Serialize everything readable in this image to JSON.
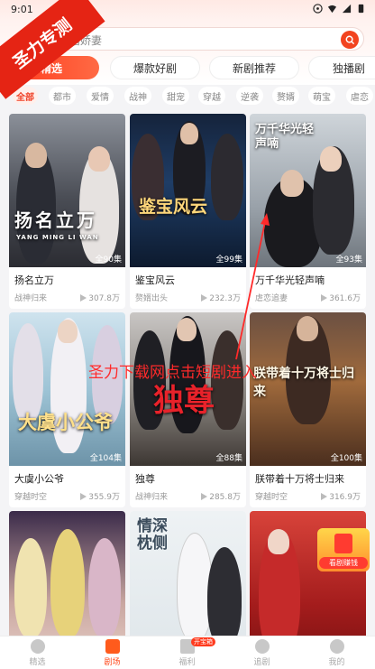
{
  "status": {
    "time": "9:01"
  },
  "watermark": {
    "text": "圣力专测"
  },
  "search": {
    "placeholder": "闪婚娇妻"
  },
  "tabs": [
    {
      "label": "精选",
      "active": true
    },
    {
      "label": "爆款好剧",
      "active": false
    },
    {
      "label": "新剧推荐",
      "active": false
    },
    {
      "label": "独播剧",
      "active": false
    }
  ],
  "categories": [
    {
      "label": "全部",
      "active": true
    },
    {
      "label": "都市"
    },
    {
      "label": "爱情"
    },
    {
      "label": "战神"
    },
    {
      "label": "甜宠"
    },
    {
      "label": "穿越"
    },
    {
      "label": "逆袭"
    },
    {
      "label": "赘婿"
    },
    {
      "label": "萌宝"
    },
    {
      "label": "虐恋"
    }
  ],
  "cards": [
    {
      "title": "扬名立万",
      "episodes": "全90集",
      "tag": "战神归来",
      "views": "307.8万",
      "poster_text": "扬名立万",
      "poster_sub": "YANG MING LI WAN"
    },
    {
      "title": "鉴宝风云",
      "episodes": "全99集",
      "tag": "赘婿出头",
      "views": "232.3万",
      "poster_text": "鉴宝风云"
    },
    {
      "title": "万千华光轻声喃",
      "episodes": "全93集",
      "tag": "虐恋追妻",
      "views": "361.6万",
      "poster_text": "万千华光轻声喃"
    },
    {
      "title": "大虞小公爷",
      "episodes": "全104集",
      "tag": "穿越时空",
      "views": "355.9万",
      "poster_text": "大虞小公爷"
    },
    {
      "title": "独尊",
      "episodes": "全88集",
      "tag": "战神归来",
      "views": "285.8万",
      "poster_text": "独尊"
    },
    {
      "title": "朕带着十万将士归来",
      "episodes": "全100集",
      "tag": "穿越时空",
      "views": "316.9万",
      "poster_text": "朕带着十万将士归来"
    },
    {
      "title": "",
      "episodes": "",
      "tag": "",
      "views": "",
      "poster_text": ""
    },
    {
      "title": "",
      "episodes": "",
      "tag": "",
      "views": "",
      "poster_text": "情深枕侧"
    },
    {
      "title": "",
      "episodes": "",
      "tag": "",
      "views": "",
      "poster_text": ""
    }
  ],
  "promo": {
    "text": "圣力下载网点击短剧进入"
  },
  "float_badge": {
    "label": "看剧赚钱"
  },
  "nav": [
    {
      "label": "精选",
      "active": false
    },
    {
      "label": "剧场",
      "active": true
    },
    {
      "label": "福利",
      "active": false,
      "badge": "开宝箱"
    },
    {
      "label": "追剧",
      "active": false
    },
    {
      "label": "我的",
      "active": false
    }
  ],
  "colors": {
    "accent": "#ff4a1c",
    "watermark": "#e52414",
    "promo": "#ff2a2a"
  }
}
